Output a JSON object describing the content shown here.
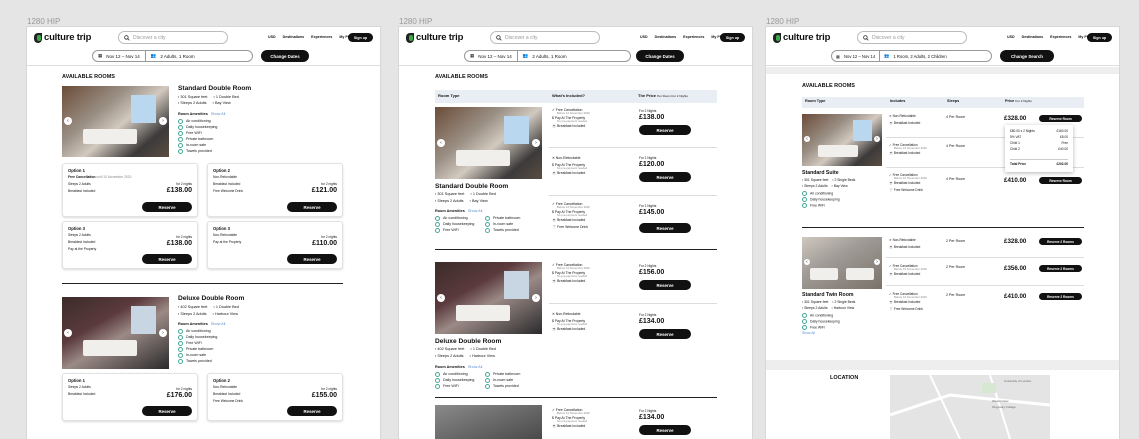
{
  "frame_label": "1280 HIP",
  "header": {
    "logo": "culture trip",
    "search_placeholder": "Discover a city",
    "nav": [
      "USD",
      "Destinations",
      "Experiences",
      "My Plans"
    ],
    "signup": "Sign up"
  },
  "subbar": {
    "dates": "Nov 12 – Nov 14",
    "guests_1": "2 Adults, 1 Room",
    "guests_3": "1 Room, 2 Adults, 2 Children",
    "change_dates": "Change Dates",
    "change_search": "Change Search"
  },
  "available_rooms": "AVAILABLE ROOMS",
  "rooms": {
    "standard": {
      "title": "Standard Double Room",
      "size": "301 Square feet",
      "bed": "1 Double Bed",
      "sleeps": "Sleeps 2 Adults",
      "view": "Bay View"
    },
    "deluxe": {
      "title": "Deluxe Double Room",
      "size": "402 Square feet",
      "bed": "1 Double Bed",
      "bed_alt": "1 Single Beds",
      "sleeps": "Sleeps 2 Adults",
      "view": "Harbour View"
    },
    "suite": {
      "title": "Standard Suite",
      "size": "301 Square feet",
      "bed": "2 Single Beds",
      "view": "Bay View"
    },
    "twin": {
      "title": "Standard Twin Room",
      "size": "301 Square feet",
      "bed": "2 Single Beds",
      "view": "Harbour View"
    }
  },
  "amenities": {
    "heading": "Room Amenities",
    "show_all": "Show All",
    "list_long": [
      "Air conditioning",
      "Daily housekeeping",
      "Free WiFi",
      "Private bathroom",
      "In-room safe",
      "Towels provided"
    ],
    "list_short": [
      "Air conditioning",
      "Daily housekeeping",
      "Free WiFi"
    ]
  },
  "options": {
    "opt1": "Option 1",
    "opt2": "Option 2",
    "opt3": "Option 3",
    "free_cancel": "Free Cancellation",
    "free_cancel_until": "until 10 November 2020",
    "before": "Before 10 November 2020",
    "no_prepay": "No pre-payment needed",
    "non_ref": "Non-Refundable",
    "breakfast": "Breakfast Included",
    "pay_prop": "Pay At The Property",
    "pay_prop_lc": "Pay at the Property",
    "welcome": "Free Welcome Drink",
    "sleeps_label": "Sleeps 2 Adults",
    "for_2_nights": "for 2 nights",
    "for_2_nights_cap": "For 2 Nights",
    "reserve": "Reserve",
    "reserve_room": "Reserve Room",
    "reserve_2": "Reserve 2 Rooms"
  },
  "prices": {
    "p138": "£138.00",
    "p121": "£121.00",
    "p110": "£110.00",
    "p176": "£176.00",
    "p155": "£155.00",
    "p120": "£120.00",
    "p145": "£145.00",
    "p156": "£156.00",
    "p134": "£134.00",
    "p328": "£328.00",
    "p410": "£410.00",
    "p356": "£356.00"
  },
  "table": {
    "room_type": "Room Type",
    "whats_included": "What's Included?",
    "the_price": "The Price",
    "per_room": "Per Room For 2 Nights",
    "includes": "Includes",
    "sleeps": "Sleeps",
    "price": "Price",
    "price_sub": "For 2 Nights",
    "per_room_2": "2 Per Room",
    "per_room_4": "4 Per Room"
  },
  "popup": {
    "r1a": "£80.00 x 2 Nights",
    "r1b": "£160.00",
    "r2a": "5% VAT",
    "r2b": "£8.00",
    "r3a": "Child 1",
    "r3b": "Free",
    "r4a": "Child 2",
    "r4b": "£40.00",
    "total": "Total Price",
    "total_v": "£202.00"
  },
  "location": "LOCATION",
  "map_labels": [
    "Westminster",
    "Kingsway College",
    "University of London"
  ]
}
